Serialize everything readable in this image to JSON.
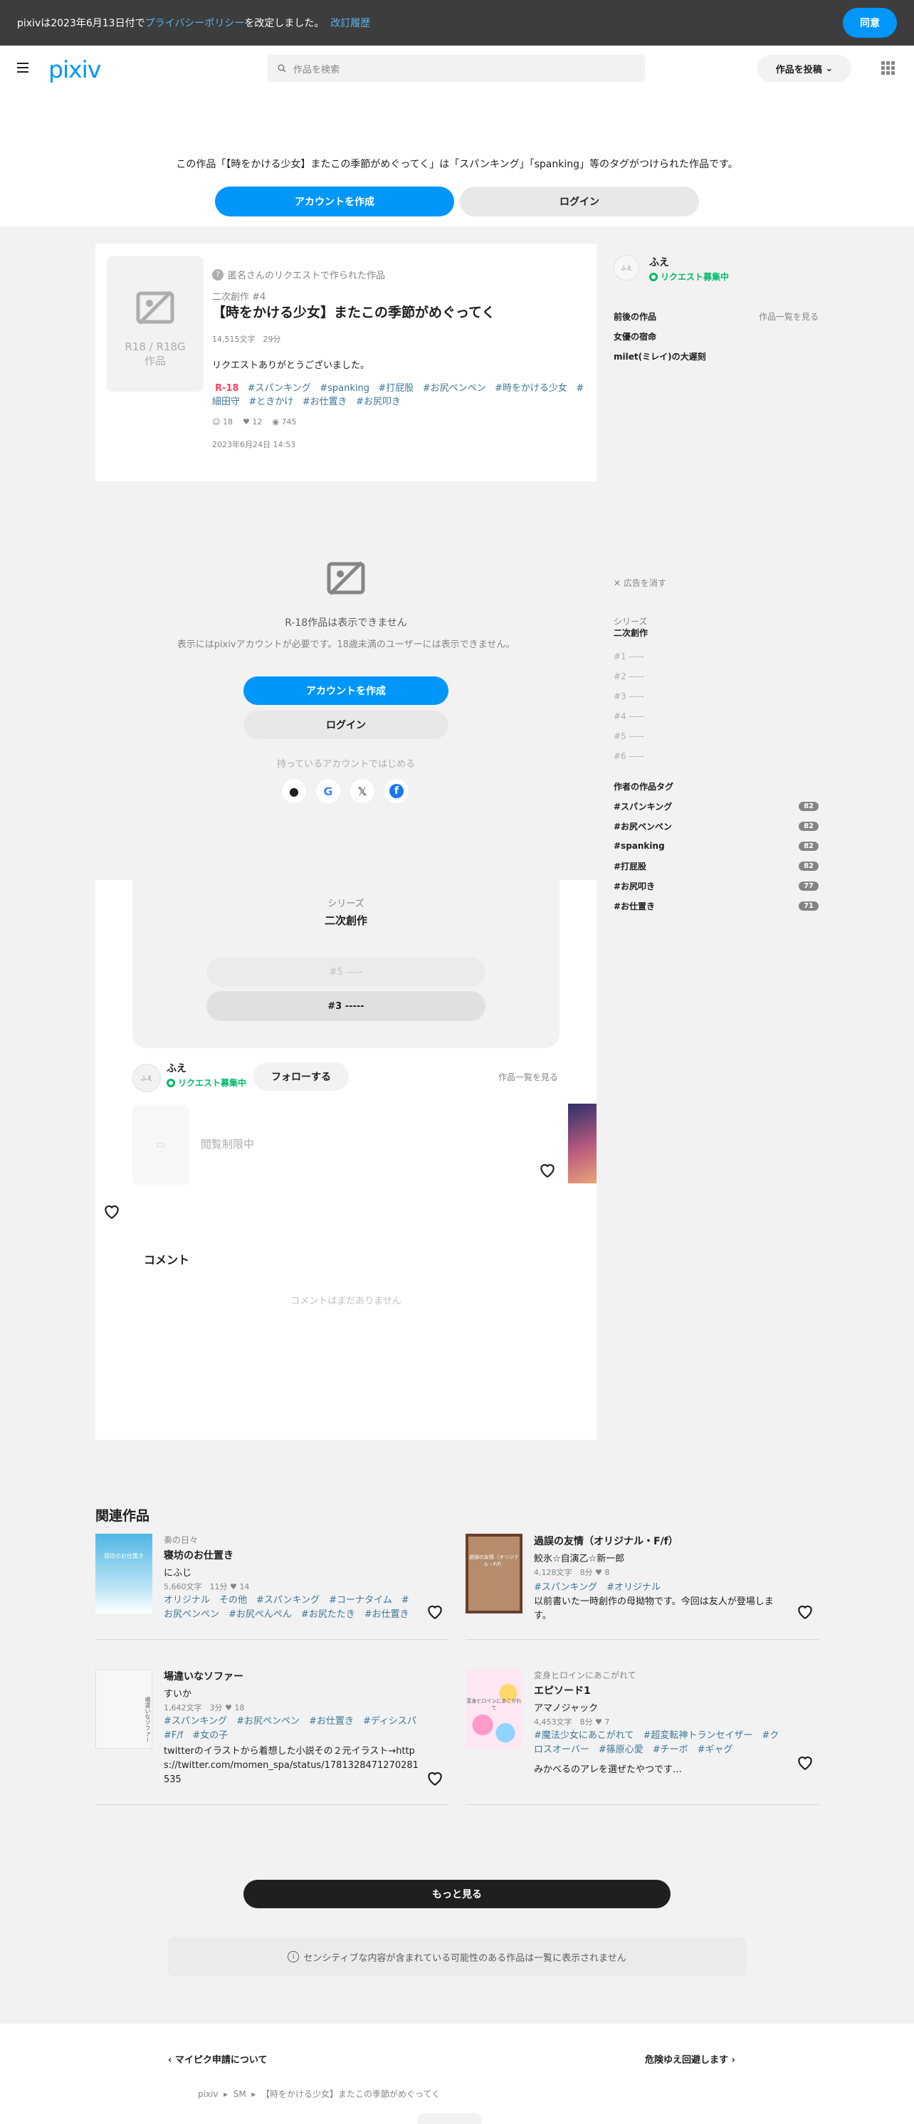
{
  "banner": {
    "text_before": "pixivは2023年6月13日付で",
    "policy_link": "プライバシーポリシー",
    "text_after": "を改定しました。",
    "history_link": "改訂履歴",
    "agree_label": "同意"
  },
  "header": {
    "logo": "pixiv",
    "search_placeholder": "作品を検索",
    "post_label": "作品を投稿"
  },
  "notice": {
    "text": "この作品「【時をかける少女】またこの季節がめぐってく」は「スパンキング」「spanking」等のタグがつけられた作品です。",
    "create_account": "アカウントを作成",
    "login": "ログイン"
  },
  "work": {
    "thumb_label_1": "R18 / R18G",
    "thumb_label_2": "作品",
    "request_note": "匿名さんのリクエストで作られた作品",
    "series": "二次創作 #4",
    "title": "【時をかける少女】またこの季節がめぐってく",
    "meta": "14,515文字　29分",
    "description": "リクエストありがとうございました。",
    "rating": "R-18",
    "tags": [
      "#スパンキング",
      "#spanking",
      "#打屁股",
      "#お尻ペンペン",
      "#時をかける少女",
      "#細田守",
      "#ときかけ",
      "#お仕置き",
      "#お尻叩き"
    ],
    "likes": "18",
    "bookmarks": "12",
    "views": "745",
    "date": "2023年6月24日 14:53"
  },
  "gate": {
    "heading": "R-18作品は表示できません",
    "sub": "表示にはpixivアカウントが必要です。18歳未満のユーザーには表示できません。",
    "create_account": "アカウントを作成",
    "login": "ログイン",
    "existing": "持っているアカウントではじめる"
  },
  "series_box": {
    "label": "シリーズ",
    "name": "二次創作",
    "next": "#5 -----",
    "prev": "#3 -----"
  },
  "author": {
    "name": "ふえ",
    "request": "リクエスト募集中",
    "follow": "フォローする",
    "all_works": "作品一覧を見る",
    "restricted": "閲覧制限中"
  },
  "comments": {
    "heading": "コメント",
    "empty": "コメントはまだありません"
  },
  "side": {
    "author_name": "ふえ",
    "request": "リクエスト募集中",
    "nav_heading": "前後の作品",
    "nav_all": "作品一覧を見る",
    "nav_items": [
      "女優の宿命",
      "milet(ミレイ)の大遅刻"
    ],
    "ad_close": "✕ 広告を消す",
    "series_label": "シリーズ",
    "series_name": "二次創作",
    "series_items": [
      "#1 -----",
      "#2 -----",
      "#3 -----",
      "#4 -----",
      "#5 -----",
      "#6 -----"
    ],
    "tags_heading": "作者の作品タグ",
    "tags": [
      {
        "name": "#スパンキング",
        "count": "82"
      },
      {
        "name": "#お尻ペンペン",
        "count": "82"
      },
      {
        "name": "#spanking",
        "count": "82"
      },
      {
        "name": "#打屁股",
        "count": "82"
      },
      {
        "name": "#お尻叩き",
        "count": "77"
      },
      {
        "name": "#お仕置き",
        "count": "71"
      }
    ]
  },
  "related": {
    "heading": "関連作品",
    "items": [
      {
        "series": "奏の日々",
        "title": "寝坊のお仕置き",
        "author": "にふじ",
        "meta": "5,660文字　11分",
        "likes": "14",
        "tags": "オリジナル　その他　#スパンキング　#コーナタイム　#お尻ペンペン　#お尻ぺんぺん　#お尻たたき　#お仕置き",
        "desc": "",
        "thumb_text": "寝坊のお仕置き"
      },
      {
        "series": "",
        "title": "過誤の友情（オリジナル・F/f）",
        "author": "鮫氷☆自演乙☆新一郎",
        "meta": "4,128文字　8分",
        "likes": "8",
        "tags": "#スパンキング　#オリジナル",
        "desc": "以前書いた一時創作の母拗物です。今回は友人が登場します。",
        "thumb_text": "過誤の友情（オリジナル・F/f）"
      },
      {
        "series": "",
        "title": "場違いなソファー",
        "author": "すいか",
        "meta": "1,642文字　3分",
        "likes": "18",
        "tags": "#スパンキング　#お尻ペンペン　#お仕置き　#ディシスパ　#F/f　#女の子",
        "desc": "twitterのイラストから着想した小説その２元イラスト→https://twitter.com/momen_spa/status/1781328471270281535",
        "thumb_text": "場違いなソファー"
      },
      {
        "series": "変身ヒロインにあこがれて",
        "title": "エピソード1",
        "author": "アマノジャック",
        "meta": "4,453文字　8分",
        "likes": "7",
        "tags": "#魔法少女にあこがれて　#超変転神トランセイザー　#クロスオーバー　#篠原心愛　#チーボ　#ギャグ",
        "desc": "みかべるのアレを選ぜたやつです…",
        "thumb_text": "変身ヒロインにあこがれて"
      }
    ],
    "more": "もっと見る",
    "sensitive": "センシティブな内容が含まれている可能性のある作品は一覧に表示されません"
  },
  "footer": {
    "prev_link": "マイピク申請について",
    "next_link": "危険ゆえ回避します",
    "crumbs": [
      "pixiv",
      "SM",
      "【時をかける少女】またこの季節がめぐってく"
    ]
  },
  "colors": {
    "accent": "#0096fa",
    "request_green": "#00b96b",
    "r18_red": "#ff4060",
    "tag_blue": "#3d7699"
  }
}
